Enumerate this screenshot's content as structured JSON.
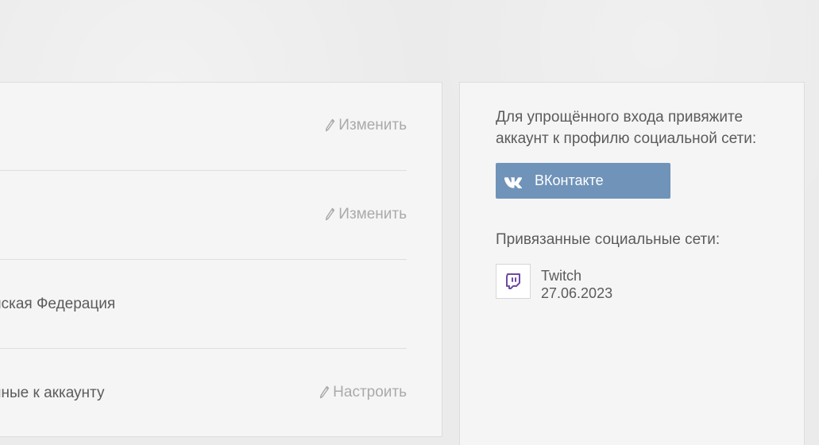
{
  "main_panel": {
    "rows": [
      {
        "label": "",
        "action_label": "Изменить"
      },
      {
        "label": "",
        "action_label": "Изменить"
      },
      {
        "label": "йская Федерация",
        "action_label": ""
      },
      {
        "label": "нные к аккаунту",
        "action_label": "Настроить"
      }
    ]
  },
  "social_panel": {
    "intro_text": "Для упрощённого входа привяжите\nаккаунт к профилю социальной сети:",
    "vk_button_label": "ВКонтакте",
    "linked_title": "Привязанные социальные сети:",
    "linked": [
      {
        "name": "Twitch",
        "date": "27.06.2023",
        "icon": "twitch-icon"
      }
    ]
  },
  "colors": {
    "background": "#ebebeb",
    "panel": "#f5f5f5",
    "border": "#dddddd",
    "text": "#5b5b5b",
    "muted_action": "#aaaaaa",
    "vk_button": "#7093b9",
    "twitch_purple": "#6e4aa3"
  }
}
